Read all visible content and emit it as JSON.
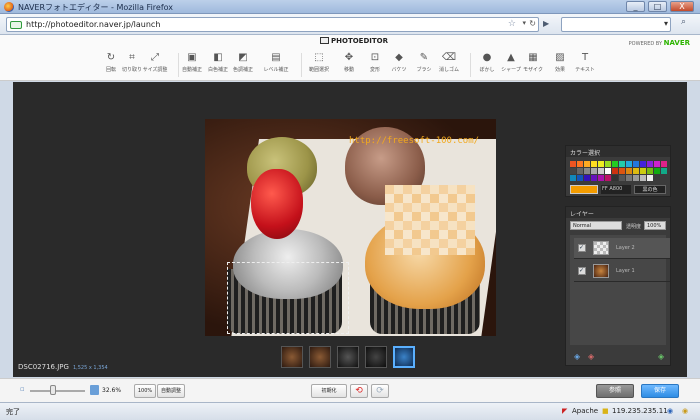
{
  "window": {
    "title": "NAVERフォトエディター - Mozilla Firefox",
    "min": "_",
    "max": "□",
    "close": "X"
  },
  "navbar": {
    "url": "http://photoeditor.naver.jp/launch",
    "star": "☆",
    "drop": "▾",
    "reload": "↻",
    "search_placeholder": "",
    "search_go": "▾"
  },
  "app": {
    "brand": "PHOTOEDITOR",
    "powered_prefix": "POWERED BY",
    "powered_brand": "NAVER"
  },
  "tools": [
    {
      "icon": "↻",
      "label": "回転"
    },
    {
      "icon": "⌗",
      "label": "切り取り"
    },
    {
      "icon": "⤢",
      "label": "サイズ調整"
    },
    {
      "icon": "▣",
      "label": "自動補正"
    },
    {
      "icon": "◧",
      "label": "白色補正"
    },
    {
      "icon": "◩",
      "label": "色調補正"
    },
    {
      "icon": "▤",
      "label": "レベル補正"
    },
    {
      "icon": "⬚",
      "label": "範囲選択"
    },
    {
      "icon": "✥",
      "label": "移動"
    },
    {
      "icon": "⊡",
      "label": "変形"
    },
    {
      "icon": "◆",
      "label": "バケツ"
    },
    {
      "icon": "✎",
      "label": "ブラシ"
    },
    {
      "icon": "⌫",
      "label": "消しゴム"
    },
    {
      "icon": "●",
      "label": "ぼかし"
    },
    {
      "icon": "▲",
      "label": "シャープ"
    },
    {
      "icon": "▦",
      "label": "モザイク"
    },
    {
      "icon": "▨",
      "label": "効果"
    },
    {
      "icon": "T",
      "label": "テキスト"
    }
  ],
  "canvas": {
    "watermark": "http://freesoft-100.com/",
    "filename": "DSC02716.JPG",
    "dimensions": "1,525 x 1,354"
  },
  "color_panel": {
    "title": "カラー選択",
    "hex": "FF A800",
    "black_button": "黒の色",
    "current_color": "#f39c00"
  },
  "layer_panel": {
    "title": "レイヤー",
    "blend": "Normal",
    "opacity_label": "透明度",
    "opacity": "100%",
    "layers": [
      {
        "name": "Layer 2",
        "checked": "✓"
      },
      {
        "name": "Layer 1",
        "checked": "✓"
      }
    ]
  },
  "bottom": {
    "zoom": "32.6%",
    "btn_100": "100%",
    "btn_fit": "自動調整",
    "btn_reset": "初期化",
    "btn_undo": "⟲",
    "btn_redo": "⟳",
    "btn_ref": "参照",
    "btn_save": "保存"
  },
  "status": {
    "left": "完了",
    "server": "Apache",
    "ip": "119.235.235.11"
  }
}
